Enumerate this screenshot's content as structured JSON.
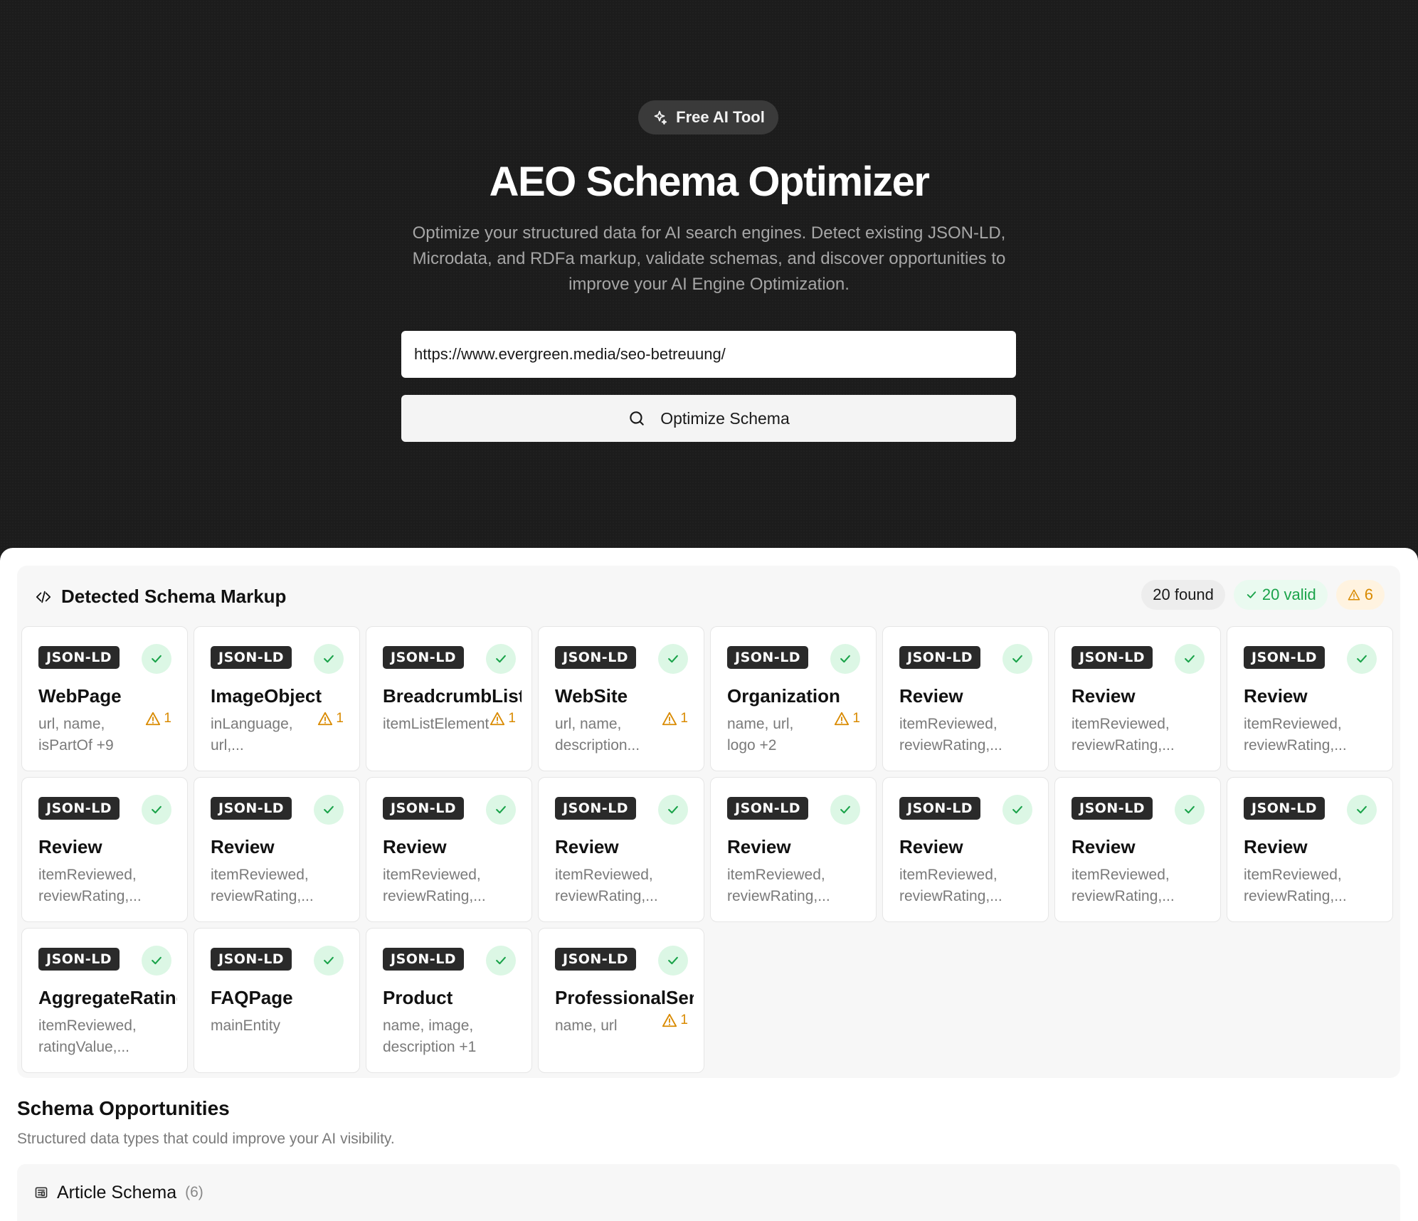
{
  "hero": {
    "badge": "Free AI Tool",
    "title": "AEO Schema Optimizer",
    "subtitle": "Optimize your structured data for AI search engines. Detect existing JSON-LD, Microdata, and RDFa markup, validate schemas, and discover opportunities to improve your AI Engine Optimization.",
    "url_value": "https://www.evergreen.media/seo-betreuung/",
    "button_label": "Optimize Schema"
  },
  "detected": {
    "title": "Detected Schema Markup",
    "found": "20 found",
    "valid": "20 valid",
    "warnings": "6",
    "cards": [
      {
        "tag": "JSON-LD",
        "type": "WebPage",
        "props1": "url, name,",
        "props2": "isPartOf +9",
        "warn": "1"
      },
      {
        "tag": "JSON-LD",
        "type": "ImageObject",
        "props1": "inLanguage,",
        "props2": "url,...",
        "warn": "1"
      },
      {
        "tag": "JSON-LD",
        "type": "BreadcrumbList",
        "props1": "itemListElement",
        "props2": "",
        "warn": "1"
      },
      {
        "tag": "JSON-LD",
        "type": "WebSite",
        "props1": "url, name,",
        "props2": "description...",
        "warn": "1"
      },
      {
        "tag": "JSON-LD",
        "type": "Organization",
        "props1": "name, url,",
        "props2": "logo +2",
        "warn": "1"
      },
      {
        "tag": "JSON-LD",
        "type": "Review",
        "props1": "itemReviewed,",
        "props2": "reviewRating,...",
        "warn": ""
      },
      {
        "tag": "JSON-LD",
        "type": "Review",
        "props1": "itemReviewed,",
        "props2": "reviewRating,...",
        "warn": ""
      },
      {
        "tag": "JSON-LD",
        "type": "Review",
        "props1": "itemReviewed,",
        "props2": "reviewRating,...",
        "warn": ""
      },
      {
        "tag": "JSON-LD",
        "type": "Review",
        "props1": "itemReviewed,",
        "props2": "reviewRating,...",
        "warn": ""
      },
      {
        "tag": "JSON-LD",
        "type": "Review",
        "props1": "itemReviewed,",
        "props2": "reviewRating,...",
        "warn": ""
      },
      {
        "tag": "JSON-LD",
        "type": "Review",
        "props1": "itemReviewed,",
        "props2": "reviewRating,...",
        "warn": ""
      },
      {
        "tag": "JSON-LD",
        "type": "Review",
        "props1": "itemReviewed,",
        "props2": "reviewRating,...",
        "warn": ""
      },
      {
        "tag": "JSON-LD",
        "type": "Review",
        "props1": "itemReviewed,",
        "props2": "reviewRating,...",
        "warn": ""
      },
      {
        "tag": "JSON-LD",
        "type": "Review",
        "props1": "itemReviewed,",
        "props2": "reviewRating,...",
        "warn": ""
      },
      {
        "tag": "JSON-LD",
        "type": "Review",
        "props1": "itemReviewed,",
        "props2": "reviewRating,...",
        "warn": ""
      },
      {
        "tag": "JSON-LD",
        "type": "Review",
        "props1": "itemReviewed,",
        "props2": "reviewRating,...",
        "warn": ""
      },
      {
        "tag": "JSON-LD",
        "type": "AggregateRating",
        "props1": "itemReviewed,",
        "props2": "ratingValue,...",
        "warn": ""
      },
      {
        "tag": "JSON-LD",
        "type": "FAQPage",
        "props1": "mainEntity",
        "props2": "",
        "warn": ""
      },
      {
        "tag": "JSON-LD",
        "type": "Product",
        "props1": "name, image,",
        "props2": "description +1",
        "warn": ""
      },
      {
        "tag": "JSON-LD",
        "type": "ProfessionalService",
        "props1": "name, url",
        "props2": "",
        "warn": "1"
      }
    ]
  },
  "opportunities": {
    "title": "Schema Opportunities",
    "subtitle": "Structured data types that could improve your AI visibility.",
    "first_item": {
      "label": "Article Schema",
      "count": "(6)"
    }
  },
  "colors": {
    "hero_bg": "#1c1c1c",
    "valid_green": "#1aa34a",
    "warn_orange": "#d98a00"
  },
  "icons": {
    "badge": "sparkles-icon",
    "button": "search-icon",
    "panel": "code-icon",
    "valid": "check-icon",
    "warn": "alert-triangle-icon",
    "opportunity": "newspaper-icon"
  }
}
